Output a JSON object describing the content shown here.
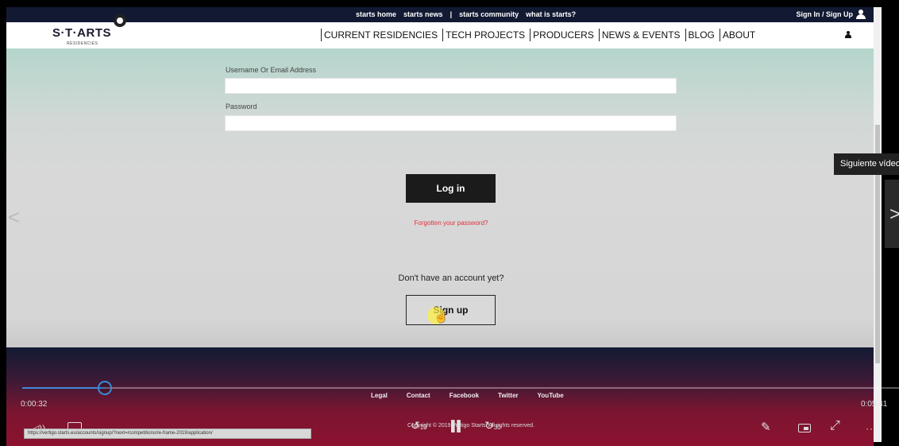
{
  "topbar": {
    "links": [
      "starts home",
      "starts news",
      "|",
      "starts community",
      "what is starts?"
    ],
    "signin_label": "Sign In / Sign Up"
  },
  "nav": {
    "logo_text": "S·T·ARTS",
    "logo_sub": "RESIDENCIES",
    "items": [
      "CURRENT RESIDENCIES",
      "TECH PROJECTS",
      "PRODUCERS",
      "NEWS & EVENTS",
      "BLOG",
      "ABOUT"
    ]
  },
  "form": {
    "username_label": "Username Or Email Address",
    "username_value": "",
    "password_label": "Password",
    "password_value": "",
    "login_button": "Log in",
    "forgot_link": "Forgotten your password?",
    "no_account_text": "Don't have an account yet?",
    "signup_button": "Sign up"
  },
  "footer": {
    "links": [
      "Legal",
      "Contact",
      "Facebook",
      "Twitter",
      "YouTube"
    ],
    "copyright": "Copyright © 2019 Vertigo Starts. All rights reserved."
  },
  "video": {
    "tooltip_next": "Siguiente vídeo",
    "time_current": "0:00:32",
    "time_end": "0:05:41",
    "progress_fraction": 0.094,
    "rewind_seconds": "10",
    "forward_seconds": "30",
    "accent_color": "#3a8bd8"
  },
  "statusbar": {
    "url": "https://vertigo.starts.eu/accounts/signup/?next=/competitions/re-frame-2019/application/"
  },
  "icons": {
    "user": "user-icon",
    "prev": "chevron-left-icon",
    "next": "chevron-right-icon",
    "volume": "volume-icon",
    "captions": "captions-icon",
    "rewind": "rewind-icon",
    "pause": "pause-icon",
    "forward": "forward-icon",
    "pen": "pen-icon",
    "miniplayer": "miniplayer-icon",
    "fullscreen": "fullscreen-icon",
    "more": "more-icon"
  }
}
